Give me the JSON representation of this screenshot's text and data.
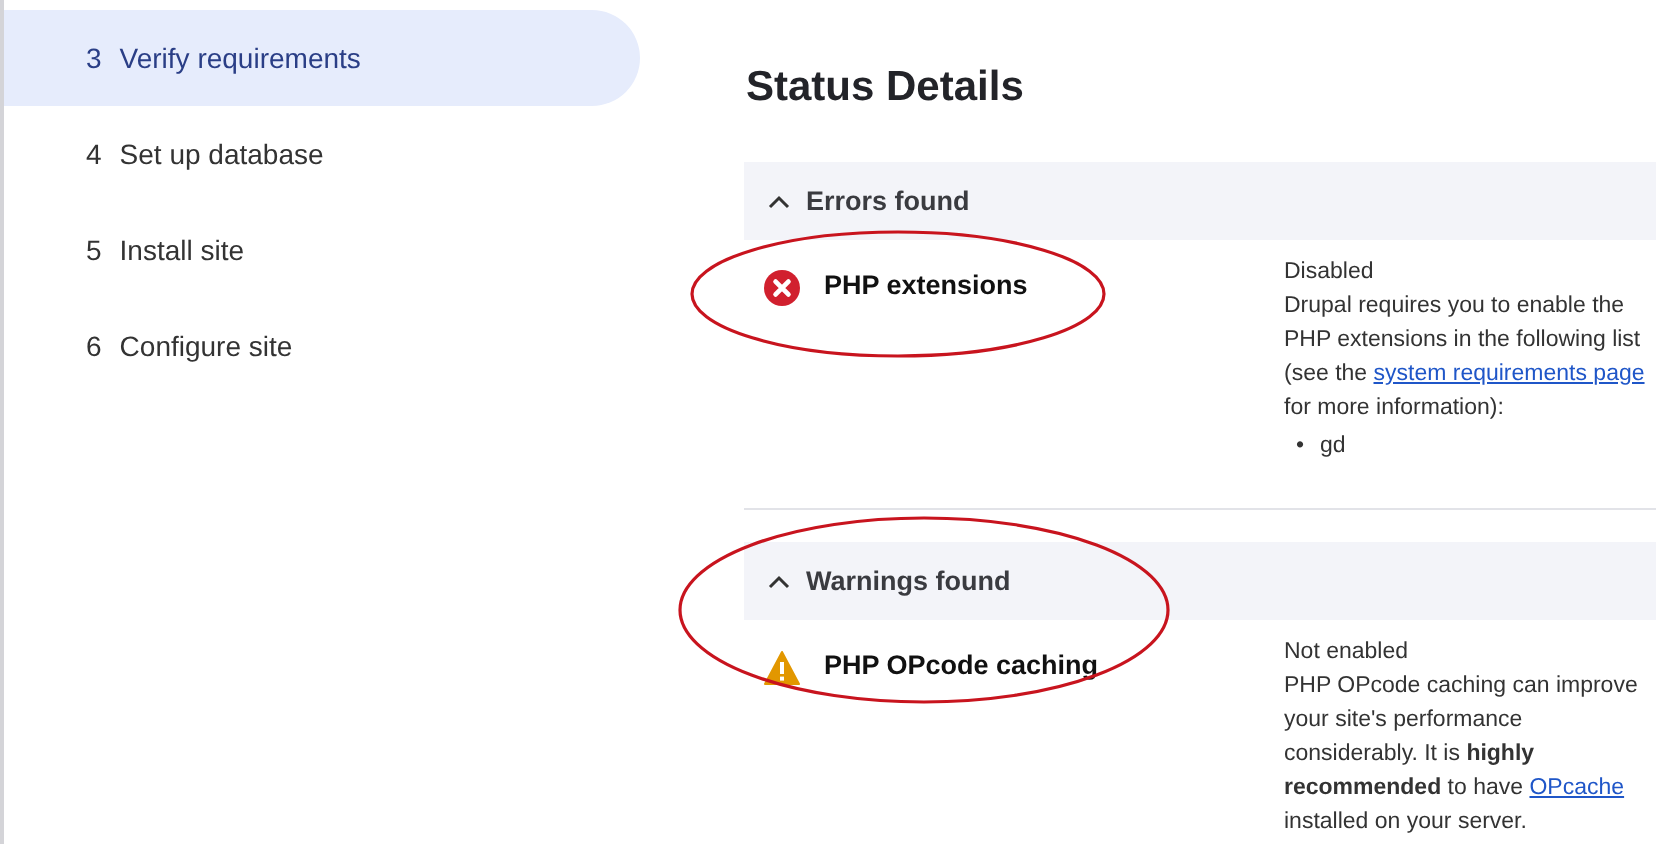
{
  "sidebar": {
    "items": [
      {
        "number": "3",
        "label": "Verify requirements",
        "selected": true
      },
      {
        "number": "4",
        "label": "Set up database",
        "selected": false
      },
      {
        "number": "5",
        "label": "Install site",
        "selected": false
      },
      {
        "number": "6",
        "label": "Configure site",
        "selected": false
      }
    ]
  },
  "main": {
    "title": "Status Details",
    "sections": [
      {
        "kind": "error",
        "heading": "Errors found",
        "expanded": true,
        "items": [
          {
            "circled": true,
            "title": "PHP extensions",
            "status": "Disabled",
            "parts": [
              {
                "kind": "text",
                "text": "Drupal requires you to enable the PHP extensions in the following list (see the "
              },
              {
                "kind": "link",
                "text": "system requirements page"
              },
              {
                "kind": "text",
                "text": " for more information):"
              }
            ],
            "list": [
              {
                "marker": "•",
                "text": "gd"
              }
            ]
          }
        ]
      },
      {
        "kind": "warning",
        "heading": "Warnings found",
        "expanded": true,
        "circled": true,
        "items": [
          {
            "title": "PHP OPcode caching",
            "status": "Not enabled",
            "parts": [
              {
                "kind": "text",
                "text": "PHP OPcode caching can improve your site's performance considerably. It is **highly recommended** to have "
              },
              {
                "kind": "link",
                "text": "OPcache"
              },
              {
                "kind": "text",
                "text": " installed on your server."
              }
            ]
          }
        ]
      }
    ]
  }
}
